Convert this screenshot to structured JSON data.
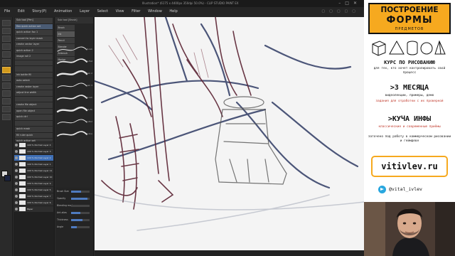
{
  "window": {
    "title": "Illustration* (6175 x 4400px 350dpi 50.0%) - CLIP STUDIO PAINT EX"
  },
  "menu": {
    "items": [
      "File",
      "Edit",
      "Story(P)",
      "Animation",
      "Layer",
      "Select",
      "View",
      "Filter",
      "Window",
      "Help"
    ]
  },
  "subtool": {
    "items": [
      "Sub tool [Pen]",
      "flex quick action set",
      "quick action fav 1",
      "convert to layer mask",
      "create vector layer",
      "quick action 2",
      "image roll 2",
      "",
      "",
      "ink bottle fill",
      "auto select",
      "create raster layer",
      "adjust line width",
      "",
      "create file object",
      "open file object",
      "quick ctrl",
      "",
      "quick mask",
      "fill ruler quick",
      "quick action set"
    ]
  },
  "brushes": {
    "header": "Sub tool [Brush]",
    "tabs": [
      "Brush",
      "Ink",
      "Pencil",
      "Blender",
      "Airbrush",
      "Marker"
    ],
    "previews": [
      "S-lab",
      "S-flat",
      "S-lab 2",
      "S-lab 3",
      "S-lab",
      "S-fill",
      "S-fill2",
      "S-line"
    ]
  },
  "layers": {
    "items": [
      {
        "name": "100 % Normal Layer 4"
      },
      {
        "name": "100 % Normal Layer 3"
      },
      {
        "name": "100 % Normal Layer 2"
      },
      {
        "name": "100 % Normal Layer 1"
      },
      {
        "name": "100 % Normal Layer 11"
      },
      {
        "name": "100 % Normal Layer 10"
      },
      {
        "name": "100 % Normal Layer 9"
      },
      {
        "name": "100 % Normal Layer 5"
      },
      {
        "name": "100 % Normal Layer 7"
      },
      {
        "name": "100 % Normal Layer 6"
      },
      {
        "name": "Paper"
      }
    ]
  },
  "props": {
    "rows": [
      {
        "label": "Brush Size",
        "value": 0.55
      },
      {
        "label": "Opacity",
        "value": 0.9
      },
      {
        "label": "Blending mode",
        "value": 0.0
      },
      {
        "label": "Ant-alias",
        "value": 0.5
      },
      {
        "label": "Thickness",
        "value": 0.6
      },
      {
        "label": "Angle",
        "value": 0.3
      }
    ]
  },
  "promo": {
    "title_line1": "ПОСТРОЕНИЕ",
    "title_line2": "ФОРМЫ",
    "title_line3": "ПРЕДМЕТОВ",
    "course_heading": "КУРС ПО РИСОВАНИЮ",
    "course_sub": "для тех, кто хочет контролировать свой процесс",
    "duration_heading": ">3 МЕСЯЦА",
    "duration_text": "видеолекции, примеры, демо",
    "duration_text_red": "задания для отработки с их проверкой",
    "info_heading": ">КУЧА ИНФЫ",
    "info_text": "классические и современные приёмы",
    "info_text2": "заточено под работу в коммерческом рисовании и геймдеве",
    "site": "vitivlev.ru",
    "telegram": "@vital_ivlev",
    "colors": {
      "accent": "#f6a91f",
      "telegram": "#29a7df"
    }
  }
}
